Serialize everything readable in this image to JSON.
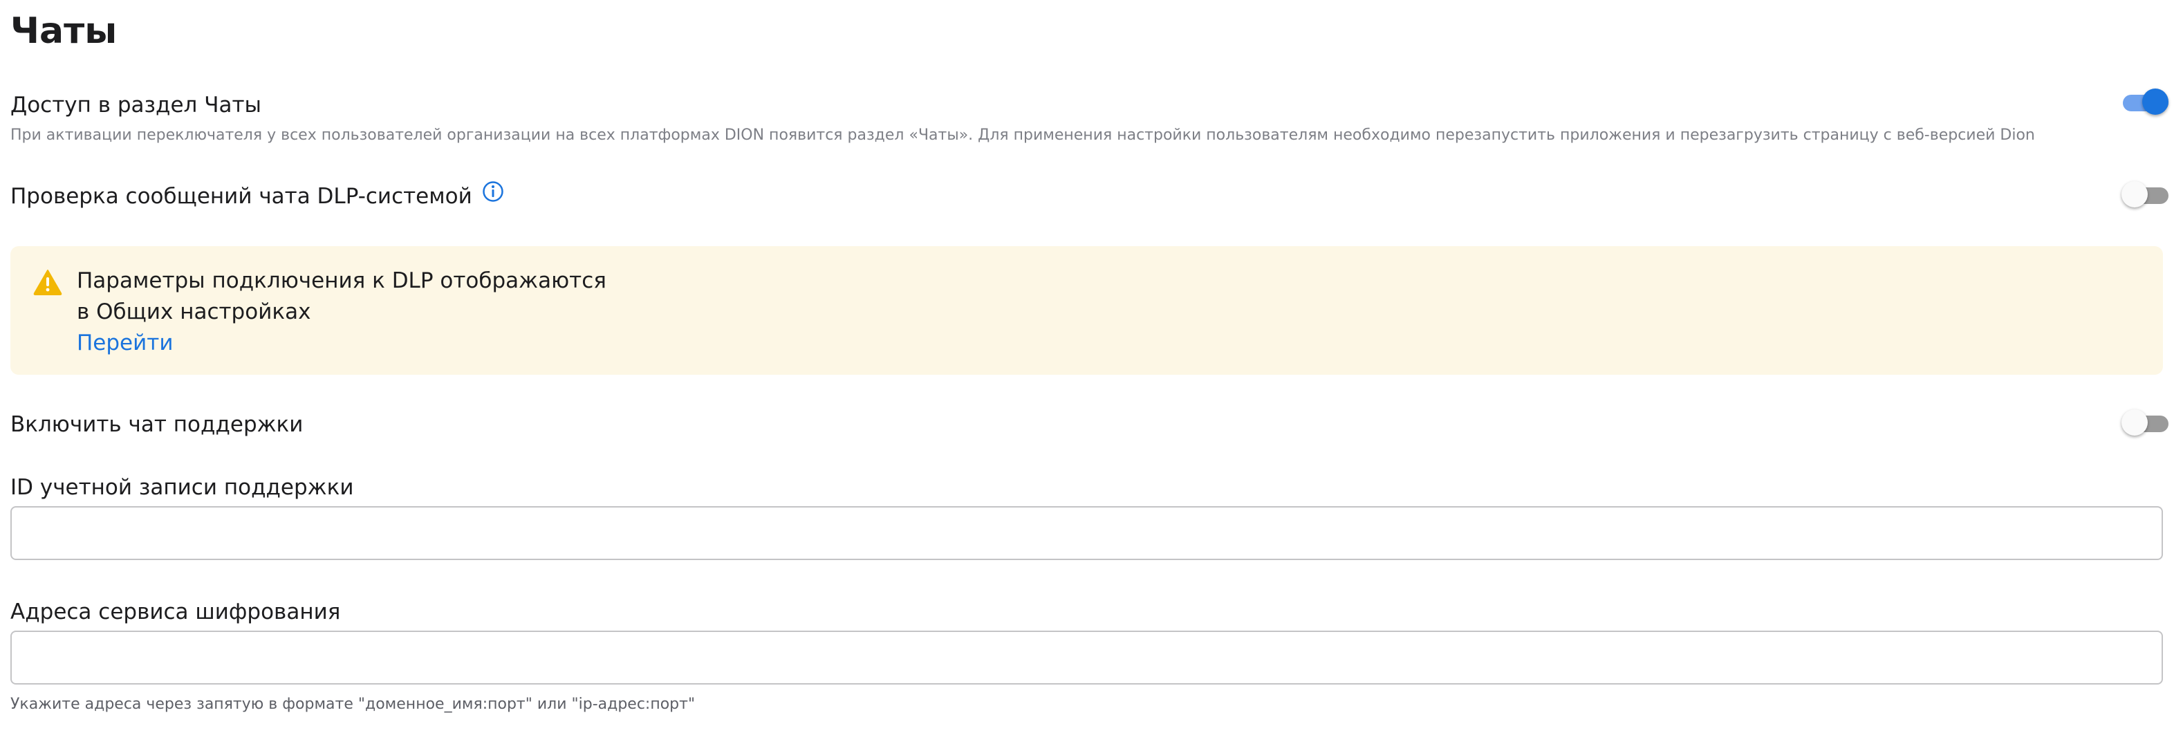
{
  "page": {
    "title": "Чаты"
  },
  "settings": {
    "chats_access": {
      "title": "Доступ в раздел Чаты",
      "description": "При активации переключателя у всех пользователей организации на всех платформах DION появится раздел «Чаты». Для применения настройки пользователям необходимо перезапустить приложения и перезагрузить страницу с веб-версией Dion",
      "enabled": true
    },
    "dlp_check": {
      "title": "Проверка сообщений чата DLP-системой",
      "icon": "info-icon",
      "enabled": false
    },
    "dlp_notice": {
      "icon": "warning-icon",
      "line1": "Параметры подключения к DLP отображаются",
      "line2": "в Общих настройках",
      "link": "Перейти"
    },
    "support_chat": {
      "title": "Включить чат поддержки",
      "enabled": false
    },
    "support_account_id": {
      "label": "ID учетной записи поддержки",
      "value": ""
    },
    "encryption_service": {
      "label": "Адреса сервиса шифрования",
      "value": "",
      "hint": "Укажите адреса через запятую в формате \"доменное_имя:порт\" или \"ip-адрес:порт\""
    }
  },
  "colors": {
    "accent": "#1b74dd",
    "toggle_on_track": "#6fa2ee",
    "toggle_off_track": "#9a9a9a",
    "notice_bg": "#fdf7e5",
    "warning": "#f2b705",
    "muted_text": "#7d7f86"
  }
}
